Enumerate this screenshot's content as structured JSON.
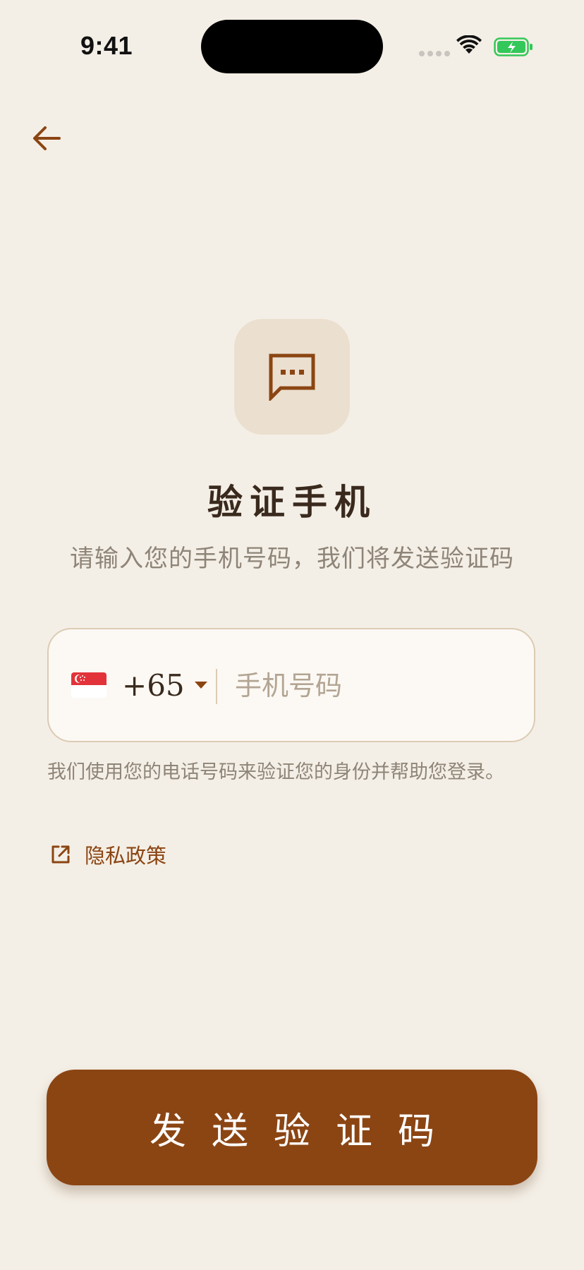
{
  "status_bar": {
    "time": "9:41",
    "battery_color": "#34C759"
  },
  "colors": {
    "background": "#F4EFE6",
    "accent": "#8B4513",
    "icon_tile": "#EBDFCF",
    "title_text": "#3A2A1E",
    "muted_text": "#8E8478"
  },
  "nav": {
    "back_icon": "arrow-left-icon"
  },
  "hero": {
    "icon": "message-dots-icon",
    "title": "验证手机",
    "subtitle": "请输入您的手机号码，我们将发送验证码"
  },
  "phone_field": {
    "flag": "singapore-flag",
    "country_code": "+65",
    "placeholder": "手机号码",
    "value": ""
  },
  "helper": {
    "text": "我们使用您的电话号码来验证您的身份并帮助您登录。"
  },
  "privacy": {
    "icon": "external-link-icon",
    "label": "隐私政策"
  },
  "submit": {
    "label": "发送验证码"
  }
}
